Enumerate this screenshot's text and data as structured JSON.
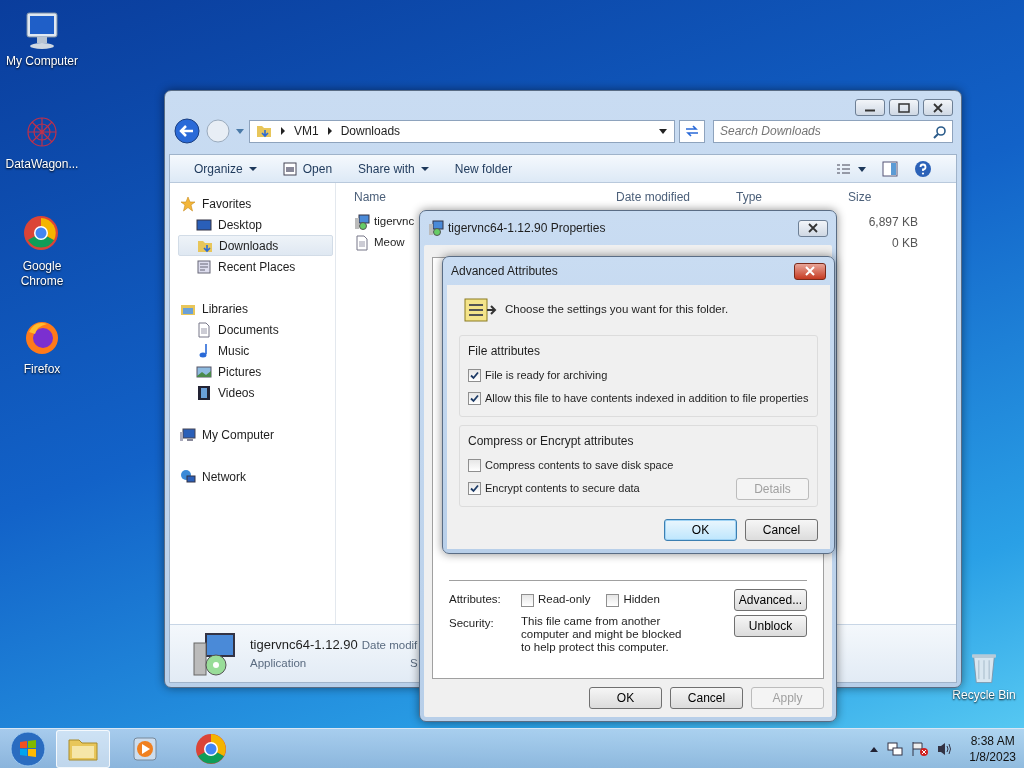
{
  "desktop_icons": [
    {
      "label": "My Computer",
      "kind": "computer"
    },
    {
      "label": "DataWagon...",
      "kind": "web"
    },
    {
      "label": "Google Chrome",
      "kind": "chrome"
    },
    {
      "label": "Firefox",
      "kind": "firefox"
    },
    {
      "label": "Recycle Bin",
      "kind": "bin"
    }
  ],
  "explorer": {
    "breadcrumb": [
      "VM1",
      "Downloads"
    ],
    "search": {
      "placeholder": "Search Downloads"
    },
    "toolbar": [
      {
        "label": "Organize",
        "dropdown": true
      },
      {
        "label": "Open",
        "dropdown": false
      },
      {
        "label": "Share with",
        "dropdown": true
      },
      {
        "label": "New folder",
        "dropdown": false
      }
    ],
    "nav": [
      {
        "label": "Favorites",
        "kind": "star",
        "children": [
          {
            "label": "Desktop",
            "kind": "desktop",
            "selected": false
          },
          {
            "label": "Downloads",
            "kind": "folder",
            "selected": true
          },
          {
            "label": "Recent Places",
            "kind": "recent",
            "selected": false
          }
        ]
      },
      {
        "label": "Libraries",
        "kind": "library",
        "children": [
          {
            "label": "Documents",
            "kind": "doc",
            "selected": false
          },
          {
            "label": "Music",
            "kind": "music",
            "selected": false
          },
          {
            "label": "Pictures",
            "kind": "picture",
            "selected": false
          },
          {
            "label": "Videos",
            "kind": "video",
            "selected": false
          }
        ]
      },
      {
        "label": "My Computer",
        "kind": "computer"
      },
      {
        "label": "Network",
        "kind": "network"
      }
    ],
    "columns": [
      "Name",
      "Date modified",
      "Type",
      "Size"
    ],
    "files": [
      {
        "name": "tigervnc",
        "size": "6,897 KB",
        "kind": "app"
      },
      {
        "name": "Meow",
        "size": "0 KB",
        "kind": "doc"
      }
    ],
    "details": {
      "name": "tigervnc64-1.12.90",
      "date_label": "Date modif",
      "type": "Application",
      "extra": "S"
    }
  },
  "properties": {
    "title": "tigervnc64-1.12.90 Properties",
    "attributes_label": "Attributes:",
    "attributes": [
      {
        "label": "Read-only",
        "checked": false
      },
      {
        "label": "Hidden",
        "checked": false
      }
    ],
    "advanced_button": "Advanced...",
    "security_label": "Security:",
    "security_text": "This file came from another computer and might be blocked to help protect this computer.",
    "unblock_button": "Unblock",
    "buttons": [
      {
        "label": "OK",
        "disabled": false
      },
      {
        "label": "Cancel",
        "disabled": false
      },
      {
        "label": "Apply",
        "disabled": true
      }
    ]
  },
  "advanced": {
    "title": "Advanced Attributes",
    "intro": "Choose the settings you want for this folder.",
    "groups": [
      {
        "title": "File attributes",
        "options": [
          {
            "label": "File is ready for archiving",
            "checked": true
          },
          {
            "label": "Allow this file to have contents indexed in addition to file properties",
            "checked": true
          }
        ]
      },
      {
        "title": "Compress or Encrypt attributes",
        "options": [
          {
            "label": "Compress contents to save disk space",
            "checked": false
          },
          {
            "label": "Encrypt contents to secure data",
            "checked": true
          }
        ],
        "button": {
          "label": "Details",
          "disabled": true
        }
      }
    ],
    "buttons": [
      {
        "label": "OK",
        "focused": true
      },
      {
        "label": "Cancel",
        "focused": false
      }
    ]
  },
  "taskbar": {
    "apps": [
      {
        "kind": "explorer",
        "active": true
      },
      {
        "kind": "media",
        "active": false
      },
      {
        "kind": "chrome",
        "active": false
      }
    ],
    "time": "8:38 AM",
    "date": "1/8/2023"
  }
}
